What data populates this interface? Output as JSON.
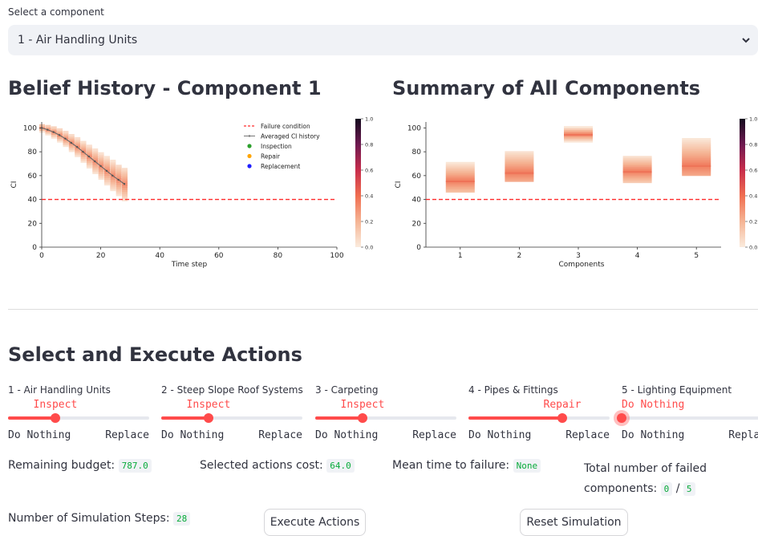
{
  "selector": {
    "label": "Select a component",
    "value": "1 - Air Handling Units",
    "icon": "chevron-down-icon"
  },
  "left_panel": {
    "title": "Belief History - Component 1"
  },
  "right_panel": {
    "title": "Summary of All Components"
  },
  "chart_data": [
    {
      "type": "heatmap",
      "xlabel": "Time step",
      "ylabel": "CI",
      "xlim": [
        0,
        100
      ],
      "ylim": [
        0,
        105
      ],
      "xticks": [
        "0",
        "20",
        "40",
        "60",
        "80",
        "100"
      ],
      "yticks": [
        "0",
        "20",
        "40",
        "60",
        "80",
        "100"
      ],
      "failure_condition": 40,
      "legend": [
        "Failure condition",
        "Averaged CI history",
        "Inspection",
        "Repair",
        "Replacement"
      ],
      "legend_colors": [
        "#ff2a2a",
        "#777777",
        "#2ca02c",
        "#ffa500",
        "#1f1fff"
      ],
      "legend_placement": "top-right",
      "colorbar_ticks": [
        "0.0",
        "0.2",
        "0.4",
        "0.6",
        "0.8",
        "1.0"
      ],
      "averaged_ci_history": {
        "x": [
          0,
          2,
          4,
          6,
          8,
          10,
          12,
          14,
          16,
          18,
          20,
          22,
          24,
          26,
          28
        ],
        "y": [
          100,
          98.5,
          96.5,
          94,
          91,
          87.5,
          84,
          80,
          76,
          72,
          68,
          64,
          60,
          56.5,
          53
        ]
      }
    },
    {
      "type": "heatmap",
      "xlabel": "Components",
      "ylabel": "CI",
      "categories": [
        "1",
        "2",
        "3",
        "4",
        "5"
      ],
      "ylim": [
        0,
        105
      ],
      "yticks": [
        "0",
        "20",
        "40",
        "60",
        "80",
        "100"
      ],
      "failure_condition": 40,
      "colorbar_ticks": [
        "0.0",
        "0.2",
        "0.4",
        "0.6",
        "0.8",
        "1.0"
      ],
      "distributions": [
        {
          "component": "1",
          "low": 46,
          "high": 70,
          "mode": 55
        },
        {
          "component": "2",
          "low": 55,
          "high": 80,
          "mode": 62
        },
        {
          "component": "3",
          "low": 88,
          "high": 100,
          "mode": 94
        },
        {
          "component": "4",
          "low": 54,
          "high": 76,
          "mode": 63
        },
        {
          "component": "5",
          "low": 60,
          "high": 90,
          "mode": 68
        }
      ]
    }
  ],
  "actions": {
    "title": "Select and Execute Actions",
    "min_label": "Do Nothing",
    "max_label": "Replace",
    "options": [
      "Do Nothing",
      "Inspect",
      "Repair",
      "Replace"
    ],
    "sliders": [
      {
        "label": "1 - Air Handling Units",
        "value": "Inspect",
        "fraction": 0.333
      },
      {
        "label": "2 - Steep Slope Roof Systems",
        "value": "Inspect",
        "fraction": 0.333
      },
      {
        "label": "3 - Carpeting",
        "value": "Inspect",
        "fraction": 0.333
      },
      {
        "label": "4 - Pipes & Fittings",
        "value": "Repair",
        "fraction": 0.667
      },
      {
        "label": "5 - Lighting Equipment",
        "value": "Do Nothing",
        "fraction": 0.0
      }
    ]
  },
  "stats": {
    "remaining_budget_label": "Remaining budget:",
    "remaining_budget": "787.0",
    "actions_cost_label": "Selected actions cost:",
    "actions_cost": "64.0",
    "mttf_label": "Mean time to failure:",
    "mttf": "None",
    "failed_label_1": "Total number of failed",
    "failed_label_2": "components:",
    "failed_count": "0",
    "failed_sep": "/",
    "failed_total": "5",
    "steps_label": "Number of Simulation Steps:",
    "steps": "28"
  },
  "buttons": {
    "execute": "Execute Actions",
    "reset": "Reset Simulation"
  }
}
